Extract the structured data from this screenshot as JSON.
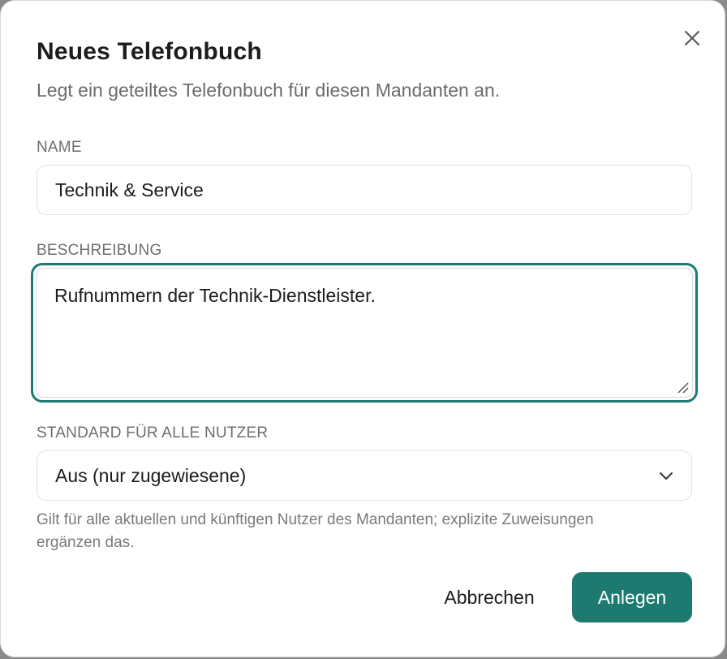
{
  "dialog": {
    "title": "Neues Telefonbuch",
    "subtitle": "Legt ein geteiltes Telefonbuch für diesen Mandanten an.",
    "close_icon": "close-icon"
  },
  "form": {
    "name": {
      "label": "NAME",
      "value": "Technik & Service"
    },
    "description": {
      "label": "BESCHREIBUNG",
      "value": "Rufnummern der Technik-Dienstleister."
    },
    "default_all_users": {
      "label": "STANDARD FÜR ALLE NUTZER",
      "selected": "Aus (nur zugewiesene)",
      "hint": "Gilt für alle aktuellen und künftigen Nutzer des Mandanten; explizite Zuweisungen ergänzen das."
    }
  },
  "actions": {
    "cancel_label": "Abbrechen",
    "submit_label": "Anlegen"
  },
  "colors": {
    "accent": "#1e7a70",
    "focus_ring": "#1c7a72"
  }
}
